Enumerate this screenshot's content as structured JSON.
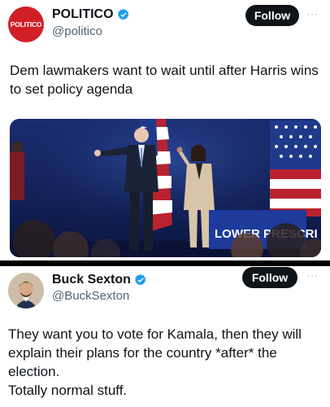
{
  "politico": {
    "avatar_text": "POLITICO",
    "display_name": "POLITICO",
    "handle": "@politico",
    "follow_label": "Follow",
    "more_label": "···",
    "text": "Dem lawmakers want to wait until after Harris wins to set policy agenda",
    "image_sign_text": "LOWER PRESCRI",
    "image_caption": "Photo: two people on a stage before a blue backdrop with American flags"
  },
  "buck": {
    "display_name": "Buck Sexton",
    "handle": "@BuckSexton",
    "follow_label": "Follow",
    "more_label": "···",
    "text_lines": [
      "They want you to vote for Kamala, then they will",
      "explain their plans for the country *after* the",
      "election.",
      "Totally normal stuff."
    ]
  },
  "colors": {
    "verified": "#1d9bf0",
    "politico_red": "#d21f26",
    "follow_bg": "#0f1419",
    "handle": "#536471"
  },
  "icons": [
    "verified-badge-icon",
    "more-options-icon"
  ]
}
